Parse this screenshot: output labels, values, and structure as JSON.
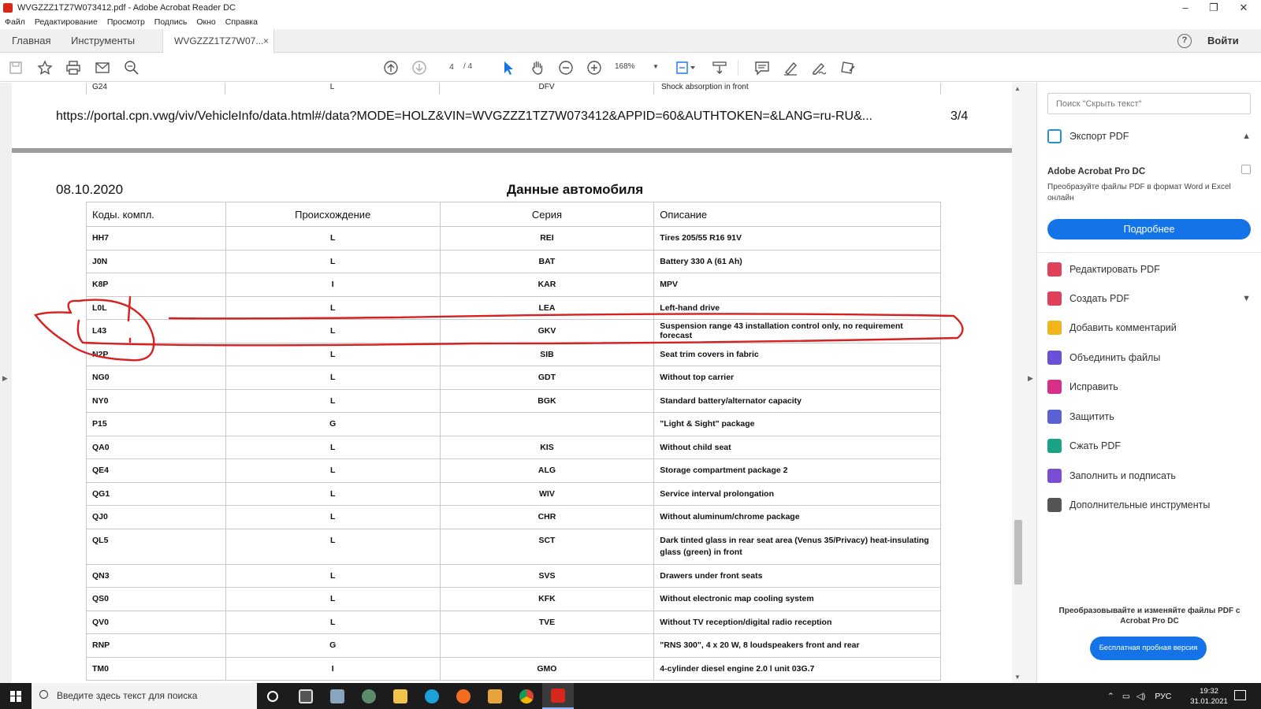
{
  "window": {
    "title": "WVGZZZ1TZ7W073412.pdf - Adobe Acrobat Reader DC",
    "minimize": "–",
    "maximize": "❐",
    "close": "✕"
  },
  "menu": [
    "Файл",
    "Редактирование",
    "Просмотр",
    "Подпись",
    "Окно",
    "Справка"
  ],
  "tabs": {
    "home": "Главная",
    "tools": "Инструменты",
    "document": "WVGZZZ1TZ7W07...",
    "close": "×",
    "help": "?",
    "login": "Войти"
  },
  "toolbar": {
    "page_current": "4",
    "page_total": "/ 4",
    "zoom": "168%",
    "icons": [
      "save-icon",
      "bookmark-icon",
      "print-icon",
      "mail-icon",
      "search-icon",
      "page-up-icon",
      "page-down-icon",
      "select-icon",
      "hand-icon",
      "zoom-out-icon",
      "zoom-in-icon",
      "fit-page-icon",
      "scroll-mode-icon",
      "comment-icon",
      "highlight-icon",
      "sign-icon",
      "redact-icon"
    ]
  },
  "previous_page": {
    "row": [
      "G24",
      "L",
      "DFV",
      "Shock absorption in front"
    ],
    "url": "https://portal.cpn.vwg/viv/VehicleInfo/data.html#/data?MODE=HOLZ&VIN=WVGZZZ1TZ7W073412&APPID=60&AUTHTOKEN=&LANG=ru-RU&...",
    "page_counter": "3/4"
  },
  "document": {
    "date": "08.10.2020",
    "heading": "Данные автомобиля",
    "table": {
      "headers": [
        "Коды. компл.",
        "Происхождение",
        "Серия",
        "Описание"
      ],
      "rows": [
        [
          "HH7",
          "L",
          "REI",
          "Tires 205/55 R16 91V"
        ],
        [
          "J0N",
          "L",
          "BAT",
          "Battery 330 A (61 Ah)"
        ],
        [
          "K8P",
          "I",
          "KAR",
          "MPV"
        ],
        [
          "L0L",
          "L",
          "LEA",
          "Left-hand drive"
        ],
        [
          "L43",
          "L",
          "GKV",
          "Suspension range 43 installation control only, no requirement forecast"
        ],
        [
          "N2P",
          "L",
          "SIB",
          "Seat trim covers in fabric"
        ],
        [
          "NG0",
          "L",
          "GDT",
          "Without top carrier"
        ],
        [
          "NY0",
          "L",
          "BGK",
          "Standard battery/alternator capacity"
        ],
        [
          "P15",
          "G",
          "",
          "\"Light & Sight\" package"
        ],
        [
          "QA0",
          "L",
          "KIS",
          "Without child seat"
        ],
        [
          "QE4",
          "L",
          "ALG",
          "Storage compartment package 2"
        ],
        [
          "QG1",
          "L",
          "WIV",
          "Service interval prolongation"
        ],
        [
          "QJ0",
          "L",
          "CHR",
          "Without aluminum/chrome package"
        ],
        [
          "QL5",
          "L",
          "SCT",
          "Dark tinted glass in rear seat area (Venus 35/Privacy) heat-insulating glass (green) in front"
        ],
        [
          "QN3",
          "L",
          "SVS",
          "Drawers under front seats"
        ],
        [
          "QS0",
          "L",
          "KFK",
          "Without electronic map cooling system"
        ],
        [
          "QV0",
          "L",
          "TVE",
          "Without TV reception/digital radio reception"
        ],
        [
          "RNP",
          "G",
          "",
          "\"RNS 300\", 4 x 20 W, 8 loudspeakers front and rear"
        ],
        [
          "TM0",
          "I",
          "GMO",
          "4-cylinder diesel engine 2.0 l unit 03G.7"
        ]
      ]
    }
  },
  "right_panel": {
    "search_placeholder": "Поиск \"Скрыть текст\"",
    "export_label": "Экспорт PDF",
    "promo_title": "Adobe Acrobat Pro DC",
    "promo_desc": "Преобразуйте файлы PDF в формат Word и Excel онлайн",
    "promo_button": "Подробнее",
    "tools": [
      {
        "label": "Редактировать PDF",
        "icon": "edit-pdf-icon",
        "color": "#e0405a"
      },
      {
        "label": "Создать PDF",
        "icon": "create-pdf-icon",
        "color": "#e0405a"
      },
      {
        "label": "Добавить комментарий",
        "icon": "comment-icon",
        "color": "#f2b41b"
      },
      {
        "label": "Объединить файлы",
        "icon": "combine-icon",
        "color": "#6a4fd8"
      },
      {
        "label": "Исправить",
        "icon": "fix-icon",
        "color": "#d8308a"
      },
      {
        "label": "Защитить",
        "icon": "protect-icon",
        "color": "#5a62d6"
      },
      {
        "label": "Сжать PDF",
        "icon": "compress-icon",
        "color": "#1aa387"
      },
      {
        "label": "Заполнить и подписать",
        "icon": "fill-sign-icon",
        "color": "#7b4dd6"
      },
      {
        "label": "Дополнительные инструменты",
        "icon": "more-tools-icon",
        "color": "#555555"
      }
    ],
    "bottom_promo": "Преобразовывайте и изменяйте файлы PDF с Acrobat Pro DC",
    "trial_button": "Бесплатная пробная версия"
  },
  "taskbar": {
    "search_placeholder": "Введите здесь текст для поиска",
    "language": "РУС",
    "time": "19:32",
    "date": "31.01.2021"
  }
}
